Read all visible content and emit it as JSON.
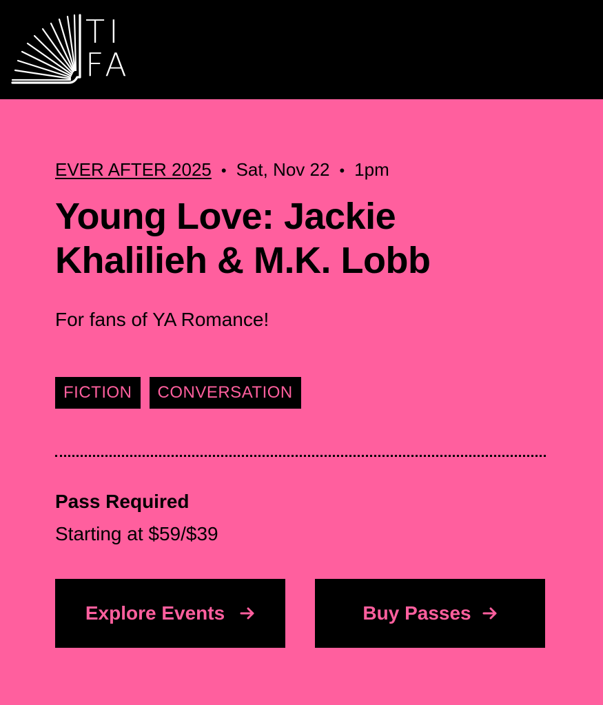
{
  "header": {
    "logo_letters_row1": "TI",
    "logo_letters_row2": "FA",
    "logo_icon": "open-book-rays-icon",
    "background": "#000000"
  },
  "event": {
    "festival_link": "EVER AFTER 2025",
    "separator": "•",
    "date": "Sat, Nov 22",
    "time": "1pm",
    "title": "Young Love: Jackie Khalilieh & M.K. Lobb",
    "subtitle": "For fans of YA Romance!",
    "tags": [
      "FICTION",
      "CONVERSATION"
    ]
  },
  "pass": {
    "heading": "Pass Required",
    "price": "Starting at $59/$39"
  },
  "buttons": {
    "explore_label": "Explore Events",
    "buy_label": "Buy Passes",
    "arrow_icon": "arrow-right-icon"
  },
  "colors": {
    "accent_pink": "#ff5f9e",
    "black": "#000000",
    "white": "#ffffff"
  }
}
